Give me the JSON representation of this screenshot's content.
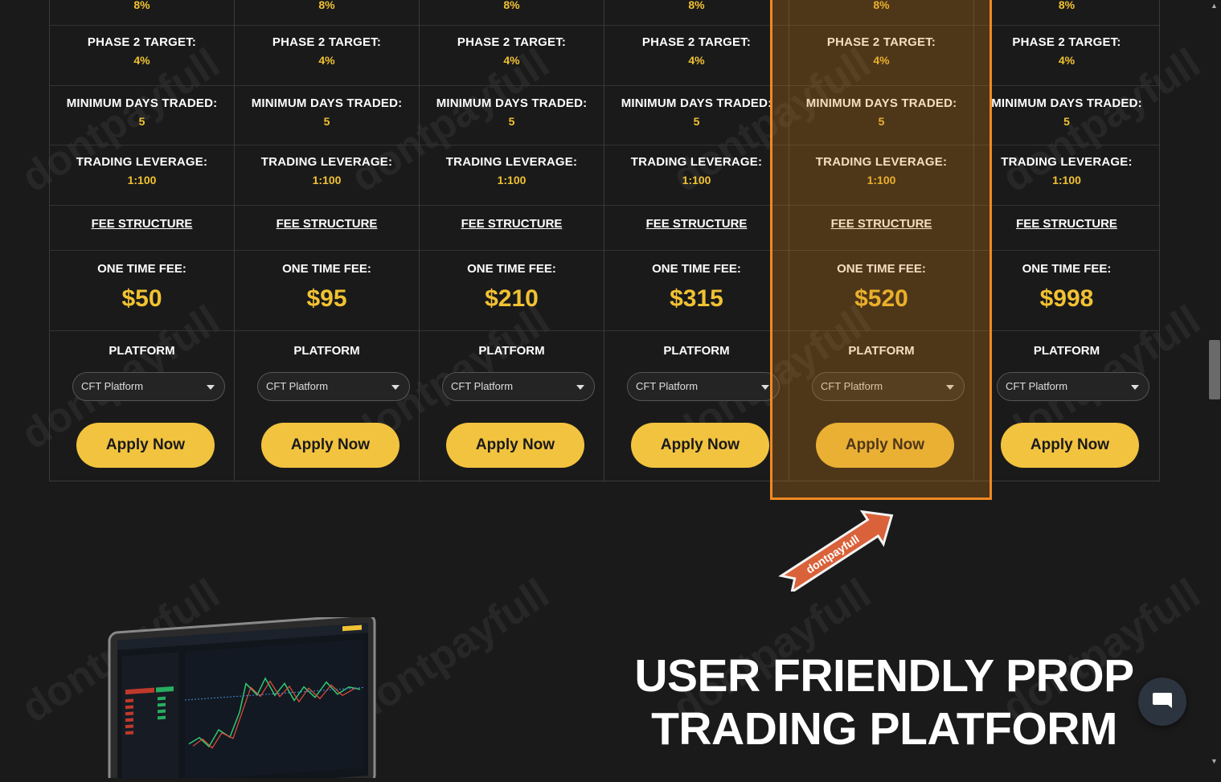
{
  "plans": [
    {
      "top_value": "8%",
      "phase2_label": "PHASE 2 TARGET:",
      "phase2_value": "4%",
      "min_days_label": "MINIMUM DAYS TRADED:",
      "min_days_value": "5",
      "leverage_label": "TRADING LEVERAGE:",
      "leverage_value": "1:100",
      "fee_structure": "FEE STRUCTURE",
      "one_time_fee_label": "ONE TIME FEE:",
      "price": "$50",
      "platform_label": "PLATFORM",
      "platform_select": "CFT Platform",
      "apply_label": "Apply Now"
    },
    {
      "top_value": "8%",
      "phase2_label": "PHASE 2 TARGET:",
      "phase2_value": "4%",
      "min_days_label": "MINIMUM DAYS TRADED:",
      "min_days_value": "5",
      "leverage_label": "TRADING LEVERAGE:",
      "leverage_value": "1:100",
      "fee_structure": "FEE STRUCTURE",
      "one_time_fee_label": "ONE TIME FEE:",
      "price": "$95",
      "platform_label": "PLATFORM",
      "platform_select": "CFT Platform",
      "apply_label": "Apply Now"
    },
    {
      "top_value": "8%",
      "phase2_label": "PHASE 2 TARGET:",
      "phase2_value": "4%",
      "min_days_label": "MINIMUM DAYS TRADED:",
      "min_days_value": "5",
      "leverage_label": "TRADING LEVERAGE:",
      "leverage_value": "1:100",
      "fee_structure": "FEE STRUCTURE",
      "one_time_fee_label": "ONE TIME FEE:",
      "price": "$210",
      "platform_label": "PLATFORM",
      "platform_select": "CFT Platform",
      "apply_label": "Apply Now"
    },
    {
      "top_value": "8%",
      "phase2_label": "PHASE 2 TARGET:",
      "phase2_value": "4%",
      "min_days_label": "MINIMUM DAYS TRADED:",
      "min_days_value": "5",
      "leverage_label": "TRADING LEVERAGE:",
      "leverage_value": "1:100",
      "fee_structure": "FEE STRUCTURE",
      "one_time_fee_label": "ONE TIME FEE:",
      "price": "$315",
      "platform_label": "PLATFORM",
      "platform_select": "CFT Platform",
      "apply_label": "Apply Now"
    },
    {
      "top_value": "8%",
      "phase2_label": "PHASE 2 TARGET:",
      "phase2_value": "4%",
      "min_days_label": "MINIMUM DAYS TRADED:",
      "min_days_value": "5",
      "leverage_label": "TRADING LEVERAGE:",
      "leverage_value": "1:100",
      "fee_structure": "FEE STRUCTURE",
      "one_time_fee_label": "ONE TIME FEE:",
      "price": "$520",
      "platform_label": "PLATFORM",
      "platform_select": "CFT Platform",
      "apply_label": "Apply Now"
    },
    {
      "top_value": "8%",
      "phase2_label": "PHASE 2 TARGET:",
      "phase2_value": "4%",
      "min_days_label": "MINIMUM DAYS TRADED:",
      "min_days_value": "5",
      "leverage_label": "TRADING LEVERAGE:",
      "leverage_value": "1:100",
      "fee_structure": "FEE STRUCTURE",
      "one_time_fee_label": "ONE TIME FEE:",
      "price": "$998",
      "platform_label": "PLATFORM",
      "platform_select": "CFT Platform",
      "apply_label": "Apply Now"
    }
  ],
  "highlighted_plan": 4,
  "arrow_label": "dontpayfull",
  "watermark_text": "dontpayfull",
  "headline": {
    "line1": "USER FRIENDLY PROP",
    "line2": "TRADING PLATFORM"
  },
  "colors": {
    "accent": "#f1c232",
    "button": "#f2c33f",
    "highlight_border": "#f08a24",
    "arrow": "#d9623a",
    "background": "#1a1a1a"
  },
  "icons": {
    "chat": "chat-bubble-icon",
    "dropdown": "chevron-down-icon"
  }
}
